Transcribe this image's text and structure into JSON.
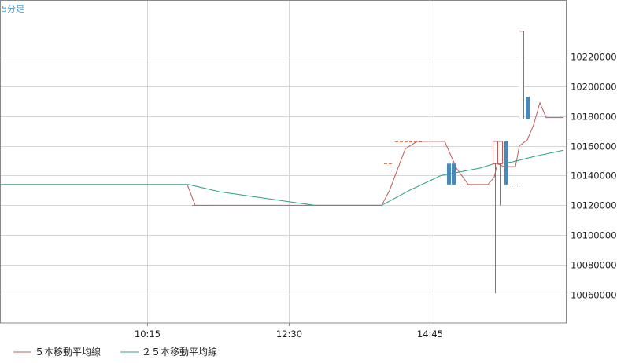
{
  "period_label": "5分足",
  "colors": {
    "plot_bg": "#ffffff",
    "frame": "#888888",
    "grid": "#d6d6d6",
    "ma5": "#c15a5a",
    "ma25": "#2aa087",
    "candle_up": "#c15a5a",
    "candle_down": "#4a88b8",
    "dash": "#e07a50",
    "period_text": "#3aa0d8"
  },
  "chart_data": {
    "type": "line",
    "title": "",
    "x_ticks": [
      "10:15",
      "12:30",
      "14:45"
    ],
    "y_ticks": [
      1006000,
      1008000,
      1010000,
      1012000,
      1014000,
      1016000,
      1018000,
      1020000,
      1022000
    ],
    "y_tick_labels": [
      "10060000",
      "10080000",
      "10100000",
      "10120000",
      "10140000",
      "10160000",
      "10180000",
      "10200000",
      "10220000"
    ],
    "ylim": [
      1004100,
      1025800
    ],
    "grid": true,
    "legend": "bottom-left",
    "series": [
      {
        "name": "５本移動平均線",
        "points": [
          [
            0,
            1013400
          ],
          [
            238,
            1013400
          ],
          [
            248,
            1012000
          ],
          [
            268,
            1012000
          ],
          [
            400,
            1012000
          ],
          [
            485,
            1012000
          ],
          [
            495,
            1013000
          ],
          [
            515,
            1015800
          ],
          [
            530,
            1016300
          ],
          [
            565,
            1016300
          ],
          [
            580,
            1014500
          ],
          [
            595,
            1013400
          ],
          [
            620,
            1013400
          ],
          [
            628,
            1013900
          ],
          [
            632,
            1014800
          ],
          [
            640,
            1014600
          ],
          [
            655,
            1014600
          ],
          [
            660,
            1016000
          ],
          [
            670,
            1016400
          ],
          [
            678,
            1017400
          ],
          [
            686,
            1018900
          ],
          [
            694,
            1017900
          ],
          [
            716,
            1017900
          ]
        ]
      },
      {
        "name": "２５本移動平均線",
        "points": [
          [
            0,
            1013400
          ],
          [
            240,
            1013400
          ],
          [
            280,
            1012900
          ],
          [
            320,
            1012600
          ],
          [
            360,
            1012300
          ],
          [
            400,
            1012000
          ],
          [
            485,
            1012000
          ],
          [
            520,
            1013000
          ],
          [
            560,
            1014000
          ],
          [
            590,
            1014300
          ],
          [
            610,
            1014500
          ],
          [
            628,
            1014800
          ],
          [
            650,
            1014900
          ],
          [
            680,
            1015300
          ],
          [
            716,
            1015700
          ]
        ]
      }
    ],
    "candles": [
      {
        "x": 570,
        "open": 1014800,
        "close": 1013400,
        "high": 1014800,
        "low": 1013400,
        "dir": "down"
      },
      {
        "x": 576,
        "open": 1014800,
        "close": 1013400,
        "high": 1014800,
        "low": 1013400,
        "dir": "down"
      },
      {
        "x": 629,
        "open": 1014800,
        "close": 1016300,
        "high": 1016300,
        "low": 1006100,
        "dir": "up"
      },
      {
        "x": 635,
        "open": 1014800,
        "close": 1016300,
        "high": 1016300,
        "low": 1012000,
        "dir": "up"
      },
      {
        "x": 643,
        "open": 1016300,
        "close": 1013400,
        "high": 1016300,
        "low": 1013400,
        "dir": "down"
      },
      {
        "x": 662,
        "open": 1017800,
        "close": 1023700,
        "high": 1023700,
        "low": 1017800,
        "dir": "up"
      },
      {
        "x": 670,
        "open": 1019300,
        "close": 1017800,
        "high": 1019300,
        "low": 1017800,
        "dir": "down"
      }
    ],
    "dashes": [
      {
        "x1": 244,
        "x2": 266,
        "y": 1012000
      },
      {
        "x1": 488,
        "x2": 498,
        "y": 1014800
      },
      {
        "x1": 502,
        "x2": 538,
        "y": 1016300
      },
      {
        "x1": 585,
        "x2": 600,
        "y": 1013400
      },
      {
        "x1": 645,
        "x2": 658,
        "y": 1013400
      }
    ]
  }
}
